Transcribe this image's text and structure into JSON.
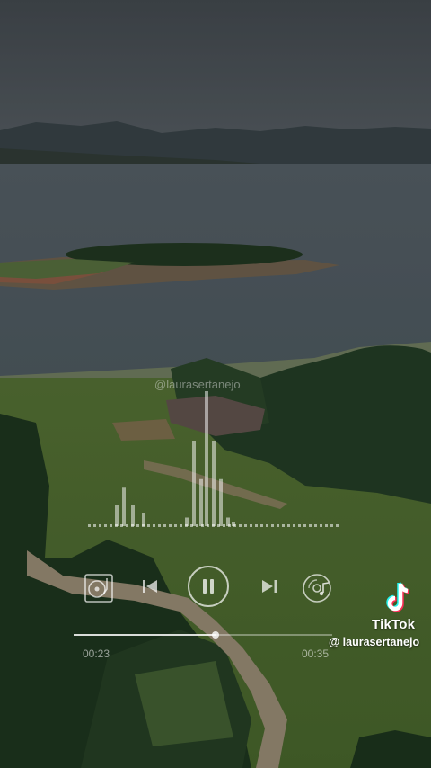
{
  "video": {
    "watermark_overlay": "@laurasertanejo",
    "brand_name": "TikTok",
    "username": "@ laurasertanejo"
  },
  "player": {
    "current_time": "00:23",
    "total_time": "00:35",
    "progress_fraction": 0.55,
    "state": "playing",
    "icons": {
      "turntable": "turntable-icon",
      "previous": "skip-previous-icon",
      "pause": "pause-icon",
      "next": "skip-next-icon",
      "music_disc": "music-disc-icon"
    }
  },
  "equalizer": {
    "bar_levels": [
      0.25,
      0.45,
      0.25,
      0.15,
      0.1,
      1.0,
      0.55,
      1.6,
      1.0,
      0.55,
      0.1,
      0.05
    ]
  },
  "colors": {
    "tiktok_cyan": "#25F4EE",
    "tiktok_red": "#FE2C55"
  }
}
